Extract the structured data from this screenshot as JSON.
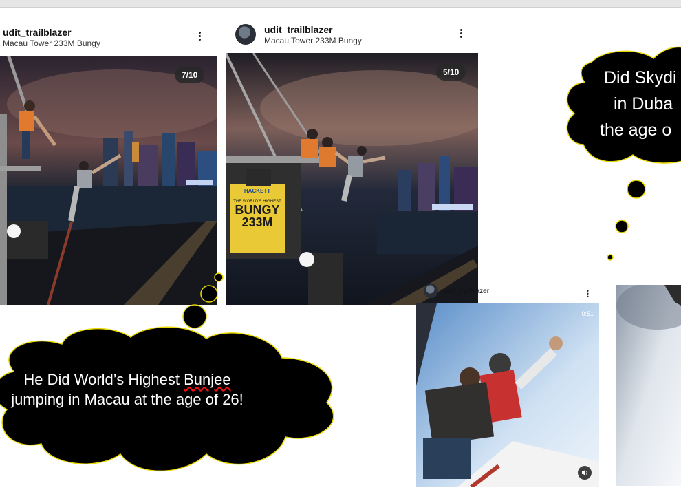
{
  "posts": [
    {
      "username": "udit_trailblazer",
      "location": "Macau Tower 233M Bungy",
      "counter": "7/10"
    },
    {
      "username": "udit_trailblazer",
      "location": "Macau Tower 233M Bungy",
      "counter": "5/10",
      "sign": {
        "brand": "HACKETT",
        "line1": "THE WORLD'S HIGHEST",
        "line2": "BUNGY",
        "line3": "233M"
      }
    },
    {
      "username": "udit_trailblazer",
      "video_time": "0:51"
    }
  ],
  "captions": {
    "bungee": {
      "part1": "He Did World’s Highest ",
      "squiggle": "Bunjee",
      "part2": " jumping in Macau at the age of 26!"
    },
    "skydive": {
      "line1": "Did Skydi",
      "line2": "in Duba",
      "line3": "the age o"
    }
  },
  "colors": {
    "bubble_fill": "#000000",
    "bubble_stroke": "#e8d800",
    "counter_bg": "#282828"
  }
}
